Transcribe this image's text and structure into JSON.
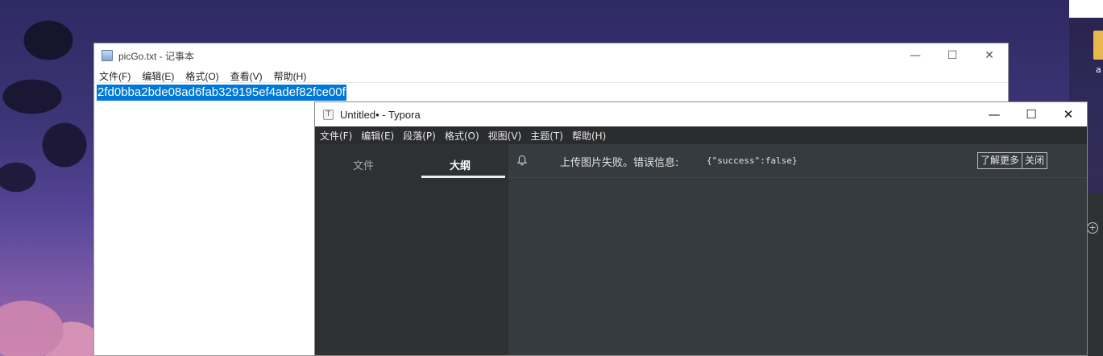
{
  "desktop": {
    "right_item_letter": "a",
    "plus_symbol": "+"
  },
  "notepad": {
    "title": "picGo.txt - 记事本",
    "controls": {
      "minimize": "—",
      "maximize": "☐",
      "close": "✕"
    },
    "menu": [
      "文件(F)",
      "编辑(E)",
      "格式(O)",
      "查看(V)",
      "帮助(H)"
    ],
    "content": "2fd0bba2bde08ad6fab329195ef4adef82fce00f",
    "selection_color": "#0078d7"
  },
  "typora": {
    "icon_letter": "T",
    "title": "Untitled• - Typora",
    "controls": {
      "minimize": "—",
      "maximize": "☐",
      "close": "✕"
    },
    "menu": [
      "文件(F)",
      "编辑(E)",
      "段落(P)",
      "格式(O)",
      "视图(V)",
      "主题(T)",
      "帮助(H)"
    ],
    "sidebar_tabs": [
      {
        "label": "文件",
        "active": false
      },
      {
        "label": "大纲",
        "active": true
      }
    ],
    "notice": {
      "icon": "bell-icon",
      "message": "上传图片失败。错误信息:",
      "code": "{\"success\":false}",
      "learn_more": "了解更多",
      "close": "关闭"
    },
    "colors": {
      "editor_bg": "#363b40",
      "sidebar_bg": "#2e3033",
      "menubar_bg": "#2b2c2e"
    }
  }
}
